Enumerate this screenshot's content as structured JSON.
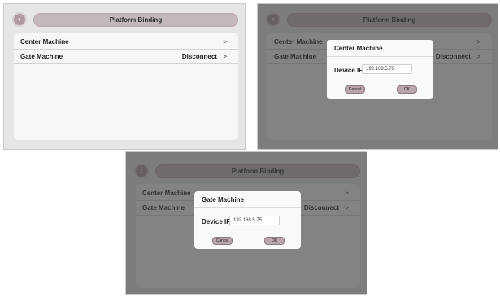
{
  "title": "Platform Binding",
  "back_icon": "chevron-left-icon",
  "rows": [
    {
      "label": "Center Machine",
      "value": "",
      "chevron": ">"
    },
    {
      "label": "Gate Machine",
      "value": "Disconnect",
      "chevron": ">"
    }
  ],
  "dialogs": [
    {
      "title": "Center Machine",
      "device_ip_label": "Device IP",
      "device_ip_value": "192.168.5.75",
      "cancel_label": "Cancel",
      "ok_label": "OK"
    },
    {
      "title": "Gate Machine",
      "device_ip_label": "Device IP",
      "device_ip_value": "192.168.5.75",
      "cancel_label": "Cancel",
      "ok_label": "OK"
    }
  ]
}
